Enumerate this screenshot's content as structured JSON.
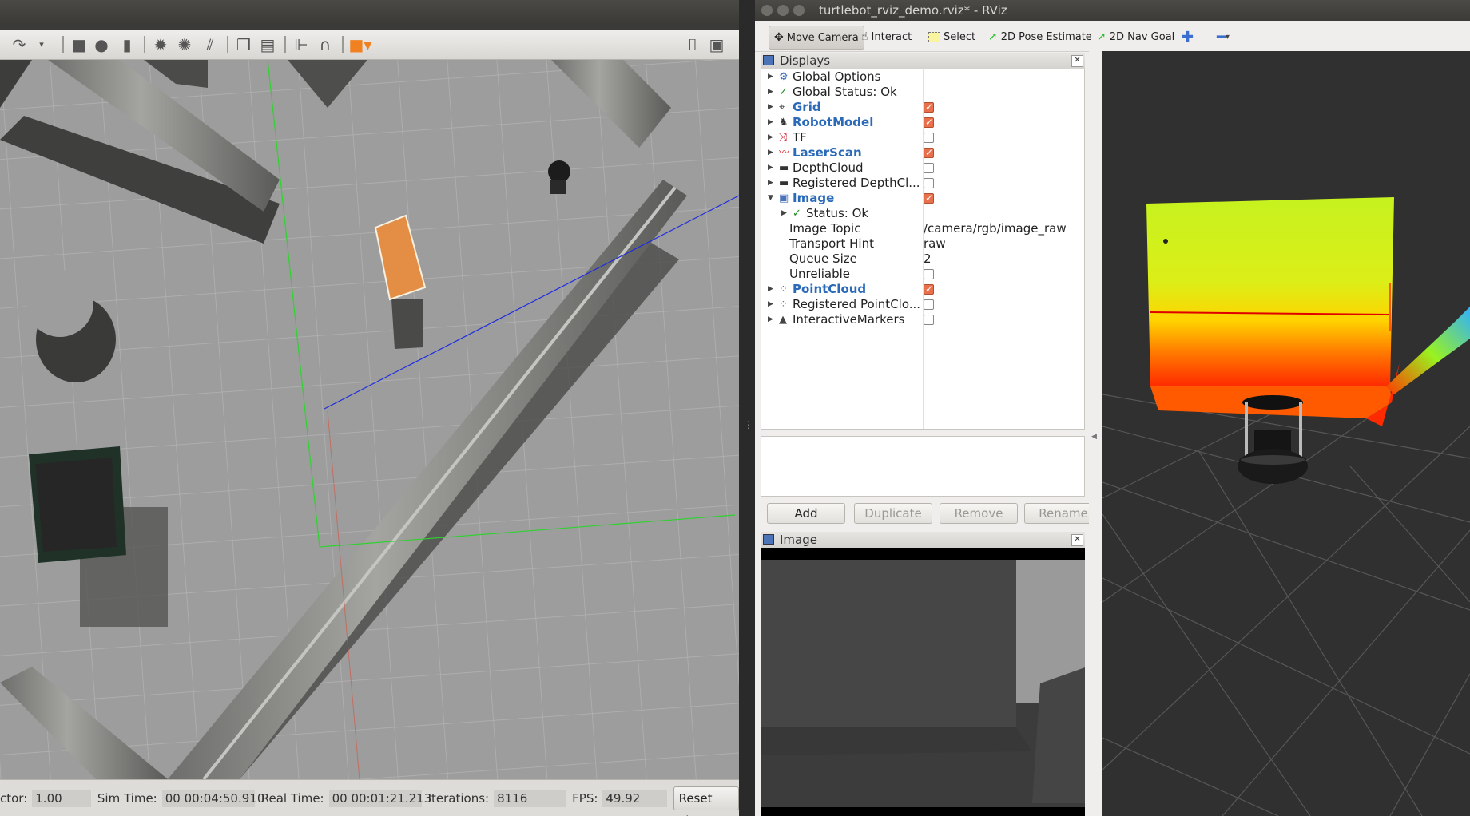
{
  "gazebo": {
    "statusbar": {
      "factor_label": "ctor:",
      "factor_value": "1.00",
      "sim_time_label": "Sim Time:",
      "sim_time_value": "00 00:04:50.910",
      "real_time_label": "Real Time:",
      "real_time_value": "00 00:01:21.213",
      "iterations_label": "Iterations:",
      "iterations_value": "8116",
      "fps_label": "FPS:",
      "fps_value": "49.92",
      "reset_label": "Reset Time"
    }
  },
  "rviz": {
    "title": "turtlebot_rviz_demo.rviz* - RViz",
    "toolbar": {
      "move_camera": "Move Camera",
      "interact": "Interact",
      "select": "Select",
      "pose_estimate": "2D Pose Estimate",
      "nav_goal": "2D Nav Goal"
    },
    "displays": {
      "header": "Displays",
      "rows": [
        {
          "label": "Global Options"
        },
        {
          "label": "Global Status: Ok"
        },
        {
          "label": "Grid"
        },
        {
          "label": "RobotModel"
        },
        {
          "label": "TF"
        },
        {
          "label": "LaserScan"
        },
        {
          "label": "DepthCloud"
        },
        {
          "label": "Registered DepthCl..."
        },
        {
          "label": "Image"
        },
        {
          "label": "Status: Ok"
        },
        {
          "label": "Image Topic",
          "value": "/camera/rgb/image_raw"
        },
        {
          "label": "Transport Hint",
          "value": "raw"
        },
        {
          "label": "Queue Size",
          "value": "2"
        },
        {
          "label": "Unreliable"
        },
        {
          "label": "PointCloud"
        },
        {
          "label": "Registered PointClo..."
        },
        {
          "label": "InteractiveMarkers"
        }
      ],
      "checked": {
        "Grid": true,
        "RobotModel": true,
        "TF": false,
        "LaserScan": true,
        "DepthCloud": false,
        "Registered DepthCl...": false,
        "Image": true,
        "Unreliable": false,
        "PointCloud": true,
        "Registered PointClo...": false,
        "InteractiveMarkers": false
      },
      "buttons": {
        "add": "Add",
        "duplicate": "Duplicate",
        "remove": "Remove",
        "rename": "Rename"
      }
    },
    "image_panel": {
      "header": "Image"
    },
    "colors": {
      "check_on": "#e8704c",
      "blue_label": "#2a6ab8",
      "grid_line_green": "#2fd22f"
    }
  }
}
